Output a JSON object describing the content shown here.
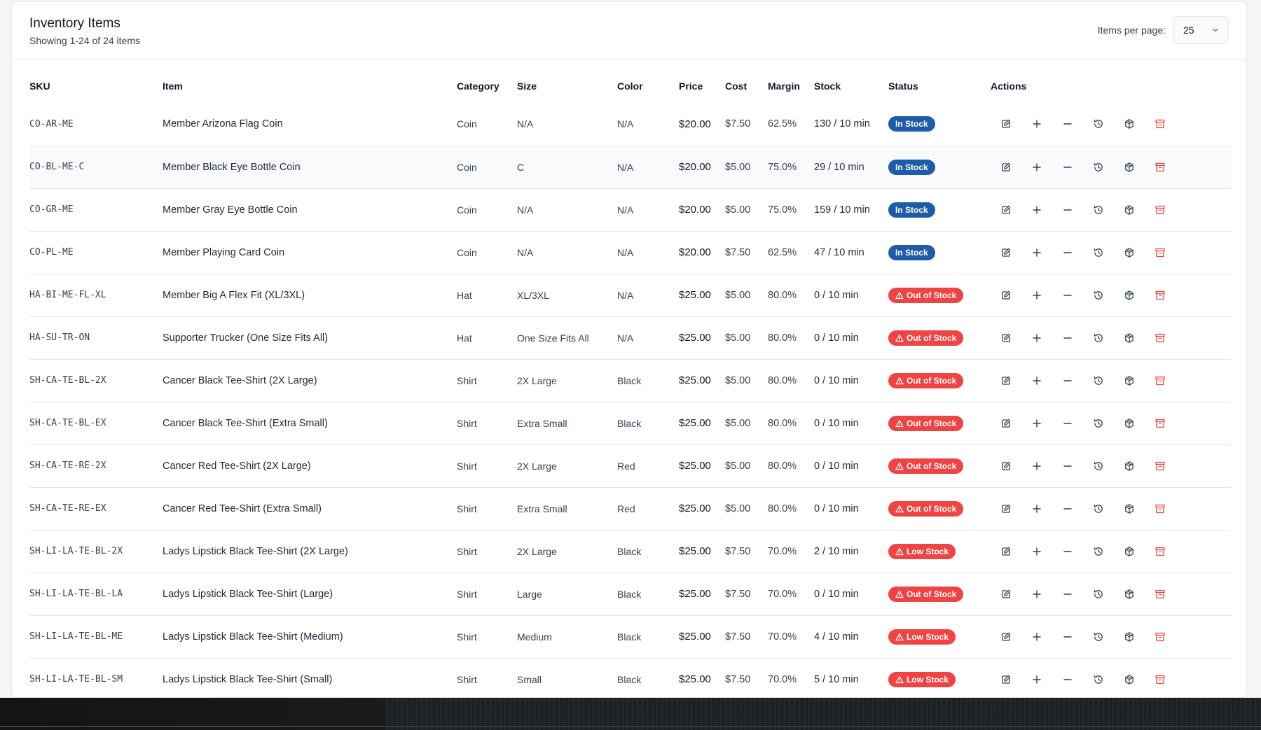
{
  "header": {
    "title": "Inventory Items",
    "subtitle": "Showing 1-24 of 24 items",
    "per_page_label": "Items per page:",
    "per_page_value": "25"
  },
  "columns": [
    "SKU",
    "Item",
    "Category",
    "Size",
    "Color",
    "Price",
    "Cost",
    "Margin",
    "Stock",
    "Status",
    "Actions"
  ],
  "colors": {
    "in_stock": "#1f5ca8",
    "alert": "#ef4444",
    "delete": "#ef4444"
  },
  "action_icons": [
    "edit-icon",
    "plus-icon",
    "minus-icon",
    "history-icon",
    "box-icon",
    "archive-icon"
  ],
  "rows": [
    {
      "sku": "CO-AR-ME",
      "item": "Member Arizona Flag Coin",
      "category": "Coin",
      "size": "N/A",
      "color": "N/A",
      "price": "$20.00",
      "cost": "$7.50",
      "margin": "62.5%",
      "stock": "130 / 10 min",
      "status": "In Stock"
    },
    {
      "sku": "CO-BL-ME-C",
      "item": "Member Black Eye Bottle Coin",
      "category": "Coin",
      "size": "C",
      "color": "N/A",
      "price": "$20.00",
      "cost": "$5.00",
      "margin": "75.0%",
      "stock": "29 / 10 min",
      "status": "In Stock"
    },
    {
      "sku": "CO-GR-ME",
      "item": "Member Gray Eye Bottle Coin",
      "category": "Coin",
      "size": "N/A",
      "color": "N/A",
      "price": "$20.00",
      "cost": "$5.00",
      "margin": "75.0%",
      "stock": "159 / 10 min",
      "status": "In Stock"
    },
    {
      "sku": "CO-PL-ME",
      "item": "Member Playing Card Coin",
      "category": "Coin",
      "size": "N/A",
      "color": "N/A",
      "price": "$20.00",
      "cost": "$7.50",
      "margin": "62.5%",
      "stock": "47 / 10 min",
      "status": "In Stock"
    },
    {
      "sku": "HA-BI-ME-FL-XL",
      "item": "Member Big A Flex Fit (XL/3XL)",
      "category": "Hat",
      "size": "XL/3XL",
      "color": "N/A",
      "price": "$25.00",
      "cost": "$5.00",
      "margin": "80.0%",
      "stock": "0 / 10 min",
      "status": "Out of Stock"
    },
    {
      "sku": "HA-SU-TR-ON",
      "item": "Supporter Trucker (One Size Fits All)",
      "category": "Hat",
      "size": "One Size Fits All",
      "color": "N/A",
      "price": "$25.00",
      "cost": "$5.00",
      "margin": "80.0%",
      "stock": "0 / 10 min",
      "status": "Out of Stock"
    },
    {
      "sku": "SH-CA-TE-BL-2X",
      "item": "Cancer Black Tee-Shirt (2X Large)",
      "category": "Shirt",
      "size": "2X Large",
      "color": "Black",
      "price": "$25.00",
      "cost": "$5.00",
      "margin": "80.0%",
      "stock": "0 / 10 min",
      "status": "Out of Stock"
    },
    {
      "sku": "SH-CA-TE-BL-EX",
      "item": "Cancer Black Tee-Shirt (Extra Small)",
      "category": "Shirt",
      "size": "Extra Small",
      "color": "Black",
      "price": "$25.00",
      "cost": "$5.00",
      "margin": "80.0%",
      "stock": "0 / 10 min",
      "status": "Out of Stock"
    },
    {
      "sku": "SH-CA-TE-RE-2X",
      "item": "Cancer Red Tee-Shirt (2X Large)",
      "category": "Shirt",
      "size": "2X Large",
      "color": "Red",
      "price": "$25.00",
      "cost": "$5.00",
      "margin": "80.0%",
      "stock": "0 / 10 min",
      "status": "Out of Stock"
    },
    {
      "sku": "SH-CA-TE-RE-EX",
      "item": "Cancer Red Tee-Shirt (Extra Small)",
      "category": "Shirt",
      "size": "Extra Small",
      "color": "Red",
      "price": "$25.00",
      "cost": "$5.00",
      "margin": "80.0%",
      "stock": "0 / 10 min",
      "status": "Out of Stock"
    },
    {
      "sku": "SH-LI-LA-TE-BL-2X",
      "item": "Ladys Lipstick Black Tee-Shirt (2X Large)",
      "category": "Shirt",
      "size": "2X Large",
      "color": "Black",
      "price": "$25.00",
      "cost": "$7.50",
      "margin": "70.0%",
      "stock": "2 / 10 min",
      "status": "Low Stock"
    },
    {
      "sku": "SH-LI-LA-TE-BL-LA",
      "item": "Ladys Lipstick Black Tee-Shirt (Large)",
      "category": "Shirt",
      "size": "Large",
      "color": "Black",
      "price": "$25.00",
      "cost": "$7.50",
      "margin": "70.0%",
      "stock": "0 / 10 min",
      "status": "Out of Stock"
    },
    {
      "sku": "SH-LI-LA-TE-BL-ME",
      "item": "Ladys Lipstick Black Tee-Shirt (Medium)",
      "category": "Shirt",
      "size": "Medium",
      "color": "Black",
      "price": "$25.00",
      "cost": "$7.50",
      "margin": "70.0%",
      "stock": "4 / 10 min",
      "status": "Low Stock"
    },
    {
      "sku": "SH-LI-LA-TE-BL-SM",
      "item": "Ladys Lipstick Black Tee-Shirt (Small)",
      "category": "Shirt",
      "size": "Small",
      "color": "Black",
      "price": "$25.00",
      "cost": "$7.50",
      "margin": "70.0%",
      "stock": "5 / 10 min",
      "status": "Low Stock"
    }
  ]
}
